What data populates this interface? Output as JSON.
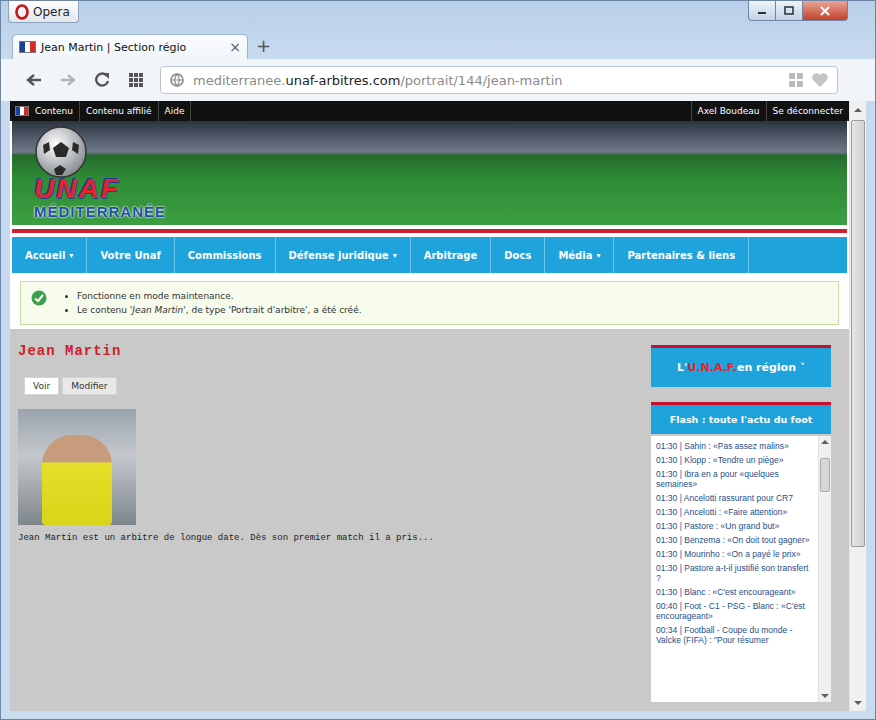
{
  "browser": {
    "menu_label": "Opera",
    "tab": {
      "title": "Jean Martin | Section régio",
      "close": "×",
      "selected": true
    },
    "new_tab": "+",
    "nav_buttons": {
      "back_enabled": true,
      "forward_enabled": false
    },
    "url": {
      "prefix": "mediterranee.",
      "domain": "unaf-arbitres.com",
      "path": "/portrait/144/jean-martin"
    }
  },
  "admin_bar": {
    "left": [
      "Contenu",
      "Contenu affilié",
      "Aide"
    ],
    "right": [
      "Axel Boudeau",
      "Se déconnecter"
    ]
  },
  "logo": {
    "top": "UNAF",
    "bottom": "MÉDITERRANÉE"
  },
  "nav": {
    "caret": "▾",
    "items": [
      {
        "label": "Accueil",
        "dropdown": true
      },
      {
        "label": "Votre Unaf",
        "dropdown": false
      },
      {
        "label": "Commissions",
        "dropdown": false
      },
      {
        "label": "Défense juridique",
        "dropdown": true
      },
      {
        "label": "Arbitrage",
        "dropdown": false
      },
      {
        "label": "Docs",
        "dropdown": false
      },
      {
        "label": "Média",
        "dropdown": true
      },
      {
        "label": "Partenaires & liens",
        "dropdown": false
      }
    ]
  },
  "messages": [
    {
      "parts": [
        {
          "text": "Fonctionne en mode maintenance.",
          "italic": false
        }
      ]
    },
    {
      "parts": [
        {
          "text": "Le contenu '",
          "italic": false
        },
        {
          "text": "Jean Martin",
          "italic": true
        },
        {
          "text": "', de type 'Portrait d'arbitre', a été créé.",
          "italic": false
        }
      ]
    }
  ],
  "node": {
    "title": "Jean Martin",
    "tabs": [
      {
        "label": "Voir",
        "selected": true
      },
      {
        "label": "Modifier",
        "selected": false
      }
    ],
    "summary": "Jean Martin est un arbitre de longue date. Dès son premier match il a pris..."
  },
  "sidebar": {
    "region_block": {
      "prefix": "L'",
      "highlight": "U.N.A.F.",
      "suffix": " en région",
      "caret": "˅"
    },
    "flash": {
      "title": "Flash : toute l'actu du foot",
      "items": [
        "01:30 | Sahin : «Pas assez malins»",
        "01:30 | Klopp : «Tendre un piège»",
        "01:30 | Ibra en a pour «quelques semaines»",
        "01:30 | Ancelotti rassurant pour CR7",
        "01:30 | Ancelotti : «Faire attention»",
        "01:30 | Pastore : «Un grand but»",
        "01:30 | Benzema : «On doit tout gagner»",
        "01:30 | Mourinho : «On a payé le prix»",
        "01:30 | Pastore a-t-il justifié son transfert ?",
        "01:30 | Blanc : «C'est encourageant»",
        "00:40 | Foot - C1 - PSG - Blanc : «C'est encourageant»",
        "00:34 | Football - Coupe du monde - Valcke (FIFA) : \"Pour résumer"
      ]
    }
  }
}
